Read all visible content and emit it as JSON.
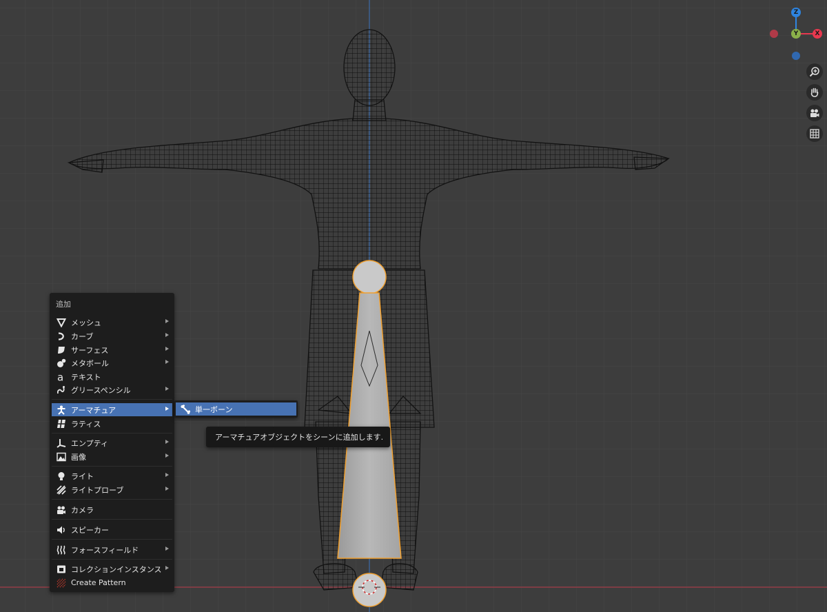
{
  "menu": {
    "title": "追加",
    "items": [
      {
        "label": "メッシュ",
        "icon": "mesh-icon",
        "submenu": true
      },
      {
        "label": "カーブ",
        "icon": "curve-icon",
        "submenu": true
      },
      {
        "label": "サーフェス",
        "icon": "surface-icon",
        "submenu": true
      },
      {
        "label": "メタボール",
        "icon": "metaball-icon",
        "submenu": true
      },
      {
        "label": "テキスト",
        "icon": "text-icon",
        "submenu": false
      },
      {
        "label": "グリースペンシル",
        "icon": "grease-pencil-icon",
        "submenu": true
      },
      {
        "label": "アーマチュア",
        "icon": "armature-icon",
        "submenu": true,
        "active": true
      },
      {
        "label": "ラティス",
        "icon": "lattice-icon",
        "submenu": false
      },
      {
        "label": "エンプティ",
        "icon": "empty-icon",
        "submenu": true
      },
      {
        "label": "画像",
        "icon": "image-icon",
        "submenu": true
      },
      {
        "label": "ライト",
        "icon": "light-icon",
        "submenu": true
      },
      {
        "label": "ライトプローブ",
        "icon": "light-probe-icon",
        "submenu": true
      },
      {
        "label": "カメラ",
        "icon": "camera-icon",
        "submenu": false
      },
      {
        "label": "スピーカー",
        "icon": "speaker-icon",
        "submenu": false
      },
      {
        "label": "フォースフィールド",
        "icon": "force-field-icon",
        "submenu": true
      },
      {
        "label": "コレクションインスタンス",
        "icon": "collection-instance-icon",
        "submenu": true
      },
      {
        "label": "Create Pattern",
        "icon": "pattern-icon",
        "submenu": false
      }
    ]
  },
  "submenu": {
    "label": "単一ボーン",
    "icon": "bone-icon"
  },
  "tooltip": "アーマチュアオブジェクトをシーンに追加します.",
  "gizmo": {
    "z": "Z",
    "y": "Y",
    "x": "X"
  },
  "nav": {
    "zoom": "zoom-icon",
    "pan": "hand-icon",
    "camera": "camera-view-icon",
    "ortho": "grid-view-icon"
  },
  "colors": {
    "accent": "#4772b3",
    "selection": "#f0a030",
    "axis_x": "#e8384f",
    "axis_y": "#8ab04a",
    "axis_z": "#2e84e0"
  }
}
